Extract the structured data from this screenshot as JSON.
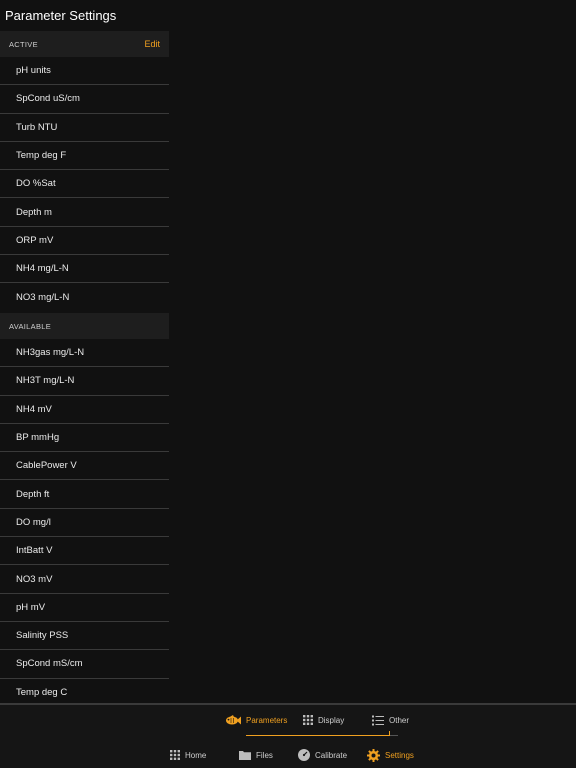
{
  "header": {
    "title": "Parameter Settings"
  },
  "active_section": {
    "label": "ACTIVE",
    "edit_label": "Edit",
    "items": [
      {
        "label": "pH units"
      },
      {
        "label": "SpCond uS/cm"
      },
      {
        "label": "Turb NTU"
      },
      {
        "label": "Temp deg F"
      },
      {
        "label": "DO %Sat"
      },
      {
        "label": "Depth m"
      },
      {
        "label": "ORP mV"
      },
      {
        "label": "NH4 mg/L-N"
      },
      {
        "label": "NO3 mg/L-N"
      }
    ]
  },
  "available_section": {
    "label": "AVAILABLE",
    "items": [
      {
        "label": "NH3gas mg/L-N"
      },
      {
        "label": "NH3T mg/L-N"
      },
      {
        "label": "NH4 mV"
      },
      {
        "label": "BP mmHg"
      },
      {
        "label": "CablePower V"
      },
      {
        "label": "Depth ft"
      },
      {
        "label": "DO mg/l"
      },
      {
        "label": "IntBatt V"
      },
      {
        "label": "NO3 mV"
      },
      {
        "label": "pH mV"
      },
      {
        "label": "Salinity PSS"
      },
      {
        "label": "SpCond mS/cm"
      },
      {
        "label": "Temp deg C"
      }
    ]
  },
  "sub_tabs": [
    {
      "label": "Parameters",
      "icon": "fish-icon",
      "active": true
    },
    {
      "label": "Display",
      "icon": "grid-icon",
      "active": false
    },
    {
      "label": "Other",
      "icon": "list-icon",
      "active": false
    }
  ],
  "main_tabs": [
    {
      "label": "Home",
      "icon": "grid-icon",
      "active": false
    },
    {
      "label": "Files",
      "icon": "folder-icon",
      "active": false
    },
    {
      "label": "Calibrate",
      "icon": "gauge-icon",
      "active": false
    },
    {
      "label": "Settings",
      "icon": "gear-icon",
      "active": true
    }
  ],
  "colors": {
    "accent": "#f0a020",
    "background": "#111111",
    "text": "#ffffff",
    "divider": "#3a3a3a"
  }
}
